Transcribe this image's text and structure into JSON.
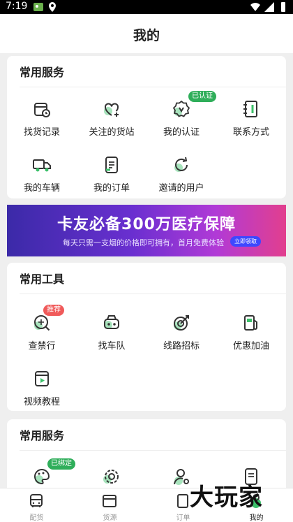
{
  "status_bar": {
    "time": "7:19",
    "icons": [
      "image-notification-icon",
      "location-icon",
      "wifi-icon",
      "signal-icon",
      "battery-icon"
    ]
  },
  "header": {
    "title": "我的"
  },
  "section1": {
    "title": "常用服务",
    "items": [
      {
        "label": "找货记录",
        "icon": "cargo-history-icon"
      },
      {
        "label": "关注的货站",
        "icon": "heart-plus-icon",
        "badge": ""
      },
      {
        "label": "我的认证",
        "icon": "verified-badge-icon",
        "badge": "已认证"
      },
      {
        "label": "联系方式",
        "icon": "contact-book-icon"
      },
      {
        "label": "我的车辆",
        "icon": "truck-icon"
      },
      {
        "label": "我的订单",
        "icon": "order-doc-icon"
      },
      {
        "label": "邀请的用户",
        "icon": "invite-refresh-icon"
      }
    ]
  },
  "banner": {
    "title": "卡友必备300万医疗保障",
    "subtitle": "每天只需一支烟的价格即可拥有，首月免费体验",
    "cta": "立即领取"
  },
  "section2": {
    "title": "常用工具",
    "items": [
      {
        "label": "查禁行",
        "icon": "restriction-search-icon",
        "badge": "推荐"
      },
      {
        "label": "找车队",
        "icon": "car-fleet-icon"
      },
      {
        "label": "线路招标",
        "icon": "route-target-icon"
      },
      {
        "label": "优惠加油",
        "icon": "fuel-pump-icon"
      },
      {
        "label": "视频教程",
        "icon": "video-tutorial-icon"
      }
    ]
  },
  "section3": {
    "title": "常用服务",
    "items": [
      {
        "label": "",
        "icon": "palette-icon",
        "badge": "已绑定"
      },
      {
        "label": "",
        "icon": "settings-gear-icon"
      },
      {
        "label": "",
        "icon": "user-key-icon"
      },
      {
        "label": "",
        "icon": "document-icon"
      }
    ]
  },
  "tabbar": {
    "items": [
      {
        "label": "配货",
        "icon": "bus-icon"
      },
      {
        "label": "货源",
        "icon": "box-icon"
      },
      {
        "label": "订单",
        "icon": "order-icon"
      },
      {
        "label": "我的",
        "icon": "profile-icon",
        "active": true
      }
    ]
  },
  "watermark": {
    "text": "大玩家"
  },
  "colors": {
    "accent": "#3cc06a",
    "badge_green": "#2fae5a",
    "badge_red": "#f05a5a",
    "icon_stroke": "#333333"
  }
}
